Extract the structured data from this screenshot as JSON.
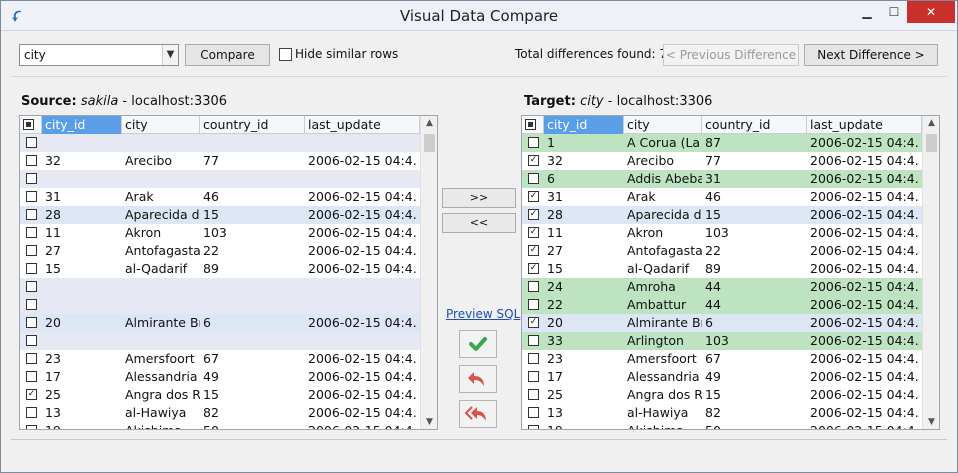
{
  "window": {
    "title": "Visual Data Compare"
  },
  "toolbar": {
    "table_select": "city",
    "compare_label": "Compare",
    "hide_similar_label": "Hide similar rows",
    "total_diffs": "Total differences found: 7",
    "prev_label": "< Previous Difference",
    "next_label": "Next Difference >"
  },
  "source": {
    "prefix": "Source:",
    "db": "sakila",
    "suffix": " - localhost:3306",
    "columns": [
      "city_id",
      "city",
      "country_id",
      "last_update"
    ],
    "rows": [
      {
        "checked": false,
        "bg": "#e6e8f4",
        "city_id": "",
        "city": "",
        "country_id": "",
        "last_update": ""
      },
      {
        "checked": false,
        "bg": "#ffffff",
        "city_id": "32",
        "city": "Arecibo",
        "country_id": "77",
        "last_update": "2006-02-15 04:4."
      },
      {
        "checked": false,
        "bg": "#e6e8f4",
        "city_id": "",
        "city": "",
        "country_id": "",
        "last_update": ""
      },
      {
        "checked": false,
        "bg": "#ffffff",
        "city_id": "31",
        "city": "Arak",
        "country_id": "46",
        "last_update": "2006-02-15 04:4."
      },
      {
        "checked": false,
        "bg": "#dde6f4",
        "city_id": "28",
        "city": "Aparecida d",
        "country_id": "15",
        "last_update": "2006-02-15 04:4."
      },
      {
        "checked": false,
        "bg": "#ffffff",
        "city_id": "11",
        "city": "Akron",
        "country_id": "103",
        "last_update": "2006-02-15 04:4."
      },
      {
        "checked": false,
        "bg": "#ffffff",
        "city_id": "27",
        "city": "Antofagasta",
        "country_id": "22",
        "last_update": "2006-02-15 04:4."
      },
      {
        "checked": false,
        "bg": "#ffffff",
        "city_id": "15",
        "city": "al-Qadarif",
        "country_id": "89",
        "last_update": "2006-02-15 04:4."
      },
      {
        "checked": false,
        "bg": "#e6e8f4",
        "city_id": "",
        "city": "",
        "country_id": "",
        "last_update": ""
      },
      {
        "checked": false,
        "bg": "#e6e8f4",
        "city_id": "",
        "city": "",
        "country_id": "",
        "last_update": ""
      },
      {
        "checked": false,
        "bg": "#dde6f4",
        "city_id": "20",
        "city": "Almirante Br",
        "country_id": "6",
        "last_update": "2006-02-15 04:4."
      },
      {
        "checked": false,
        "bg": "#e6e8f4",
        "city_id": "",
        "city": "",
        "country_id": "",
        "last_update": ""
      },
      {
        "checked": false,
        "bg": "#ffffff",
        "city_id": "23",
        "city": "Amersfoort",
        "country_id": "67",
        "last_update": "2006-02-15 04:4."
      },
      {
        "checked": false,
        "bg": "#ffffff",
        "city_id": "17",
        "city": "Alessandria",
        "country_id": "49",
        "last_update": "2006-02-15 04:4."
      },
      {
        "checked": true,
        "bg": "#ffffff",
        "city_id": "25",
        "city": "Angra dos R",
        "country_id": "15",
        "last_update": "2006-02-15 04:4."
      },
      {
        "checked": false,
        "bg": "#ffffff",
        "city_id": "13",
        "city": "al-Hawiya",
        "country_id": "82",
        "last_update": "2006-02-15 04:4."
      },
      {
        "checked": false,
        "bg": "#ffffff",
        "city_id": "19",
        "city": "Akishima",
        "country_id": "50",
        "last_update": "2006-02-15 04:4."
      }
    ]
  },
  "target": {
    "prefix": "Target:",
    "db": "city",
    "suffix": " - localhost:3306",
    "columns": [
      "city_id",
      "city",
      "country_id",
      "last_update"
    ],
    "rows": [
      {
        "checked": false,
        "bg": "#bde3c0",
        "city_id": "1",
        "city": "A Corua (La",
        "country_id": "87",
        "last_update": "2006-02-15 04:4."
      },
      {
        "checked": true,
        "bg": "#ffffff",
        "city_id": "32",
        "city": "Arecibo",
        "country_id": "77",
        "last_update": "2006-02-15 04:4."
      },
      {
        "checked": false,
        "bg": "#bde3c0",
        "city_id": "6",
        "city": "Addis Abeba",
        "country_id": "31",
        "last_update": "2006-02-15 04:4."
      },
      {
        "checked": true,
        "bg": "#ffffff",
        "city_id": "31",
        "city": "Arak",
        "country_id": "46",
        "last_update": "2006-02-15 04:4."
      },
      {
        "checked": true,
        "bg": "#dde6f4",
        "city_id": "28",
        "city": "Aparecida d",
        "country_id": "15",
        "last_update": "2006-02-15 04:4."
      },
      {
        "checked": true,
        "bg": "#ffffff",
        "city_id": "11",
        "city": "Akron",
        "country_id": "103",
        "last_update": "2006-02-15 04:4."
      },
      {
        "checked": true,
        "bg": "#ffffff",
        "city_id": "27",
        "city": "Antofagasta",
        "country_id": "22",
        "last_update": "2006-02-15 04:4."
      },
      {
        "checked": true,
        "bg": "#ffffff",
        "city_id": "15",
        "city": "al-Qadarif",
        "country_id": "89",
        "last_update": "2006-02-15 04:4."
      },
      {
        "checked": false,
        "bg": "#bde3c0",
        "city_id": "24",
        "city": "Amroha",
        "country_id": "44",
        "last_update": "2006-02-15 04:4."
      },
      {
        "checked": false,
        "bg": "#bde3c0",
        "city_id": "22",
        "city": "Ambattur",
        "country_id": "44",
        "last_update": "2006-02-15 04:4."
      },
      {
        "checked": true,
        "bg": "#dde6f4",
        "city_id": "20",
        "city": "Almirante Br",
        "country_id": "6",
        "last_update": "2006-02-15 04:4."
      },
      {
        "checked": false,
        "bg": "#bde3c0",
        "city_id": "33",
        "city": "Arlington",
        "country_id": "103",
        "last_update": "2006-02-15 04:4."
      },
      {
        "checked": false,
        "bg": "#ffffff",
        "city_id": "23",
        "city": "Amersfoort",
        "country_id": "67",
        "last_update": "2006-02-15 04:4."
      },
      {
        "checked": false,
        "bg": "#ffffff",
        "city_id": "17",
        "city": "Alessandria",
        "country_id": "49",
        "last_update": "2006-02-15 04:4."
      },
      {
        "checked": false,
        "bg": "#ffffff",
        "city_id": "25",
        "city": "Angra dos R",
        "country_id": "15",
        "last_update": "2006-02-15 04:4."
      },
      {
        "checked": false,
        "bg": "#ffffff",
        "city_id": "13",
        "city": "al-Hawiya",
        "country_id": "82",
        "last_update": "2006-02-15 04:4."
      },
      {
        "checked": false,
        "bg": "#ffffff",
        "city_id": "19",
        "city": "Akishima",
        "country_id": "50",
        "last_update": "2006-02-15 04:4."
      }
    ]
  },
  "middle": {
    "copy_right_label": ">>",
    "copy_left_label": "<<",
    "preview_sql_label": "Preview SQL",
    "apply_icon": "check-icon",
    "undo_icon": "undo-icon",
    "undo_all_icon": "undo-all-icon"
  },
  "colors": {
    "selected_header": "#5a9ee8",
    "diff_added": "#bde3c0",
    "diff_changed": "#dde6f4",
    "diff_missing": "#e6e8f4",
    "close_button": "#c9302c"
  }
}
